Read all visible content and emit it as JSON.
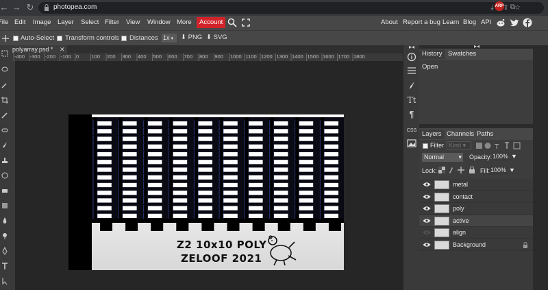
{
  "browser": {
    "url": "photopea.com",
    "avatar": "ARP"
  },
  "menu": {
    "items": [
      "File",
      "Edit",
      "Image",
      "Layer",
      "Select",
      "Filter",
      "View",
      "Window",
      "More"
    ],
    "account": "Account",
    "right_links": [
      "About",
      "Report a bug",
      "Learn",
      "Blog",
      "API"
    ],
    "social_icons": [
      "reddit-icon",
      "twitter-icon",
      "facebook-icon"
    ]
  },
  "options": {
    "auto_select": "Auto-Select",
    "transform_controls": "Transform controls",
    "distances": "Distances",
    "scale": "1x",
    "export_png": "PNG",
    "export_svg": "SVG"
  },
  "document": {
    "tab_title": "polyarray.psd *",
    "caption_line1": "Z2 10x10 POLY",
    "caption_line2": "ZELOOF 2021"
  },
  "ruler": {
    "labels": [
      "-400",
      "-300",
      "-200",
      "-100",
      "0",
      "100",
      "200",
      "300",
      "400",
      "500",
      "600",
      "700",
      "800",
      "900",
      "1000",
      "1100",
      "1200",
      "1300",
      "1400",
      "1500",
      "1600",
      "1700",
      "1800"
    ]
  },
  "history_panel": {
    "tabs": [
      "History",
      "Swatches"
    ],
    "items": [
      "Open"
    ]
  },
  "layers_panel": {
    "tabs": [
      "Layers",
      "Channels",
      "Paths"
    ],
    "filter_label": "Filter",
    "kind_label": "Kind",
    "blend_mode": "Normal",
    "opacity_label": "Opacity:",
    "opacity_value": "100%",
    "lock_label": "Lock:",
    "fill_label": "Fill:",
    "fill_value": "100%",
    "layers": [
      {
        "name": "metal",
        "visible": true
      },
      {
        "name": "contact",
        "visible": true
      },
      {
        "name": "poly",
        "visible": true
      },
      {
        "name": "active",
        "visible": true
      },
      {
        "name": "align",
        "visible": false
      },
      {
        "name": "Background",
        "visible": true,
        "locked": true
      }
    ]
  },
  "colors": {
    "account_red": "#d2232a",
    "panel_bg": "#474747",
    "canvas_bg": "#262626"
  }
}
